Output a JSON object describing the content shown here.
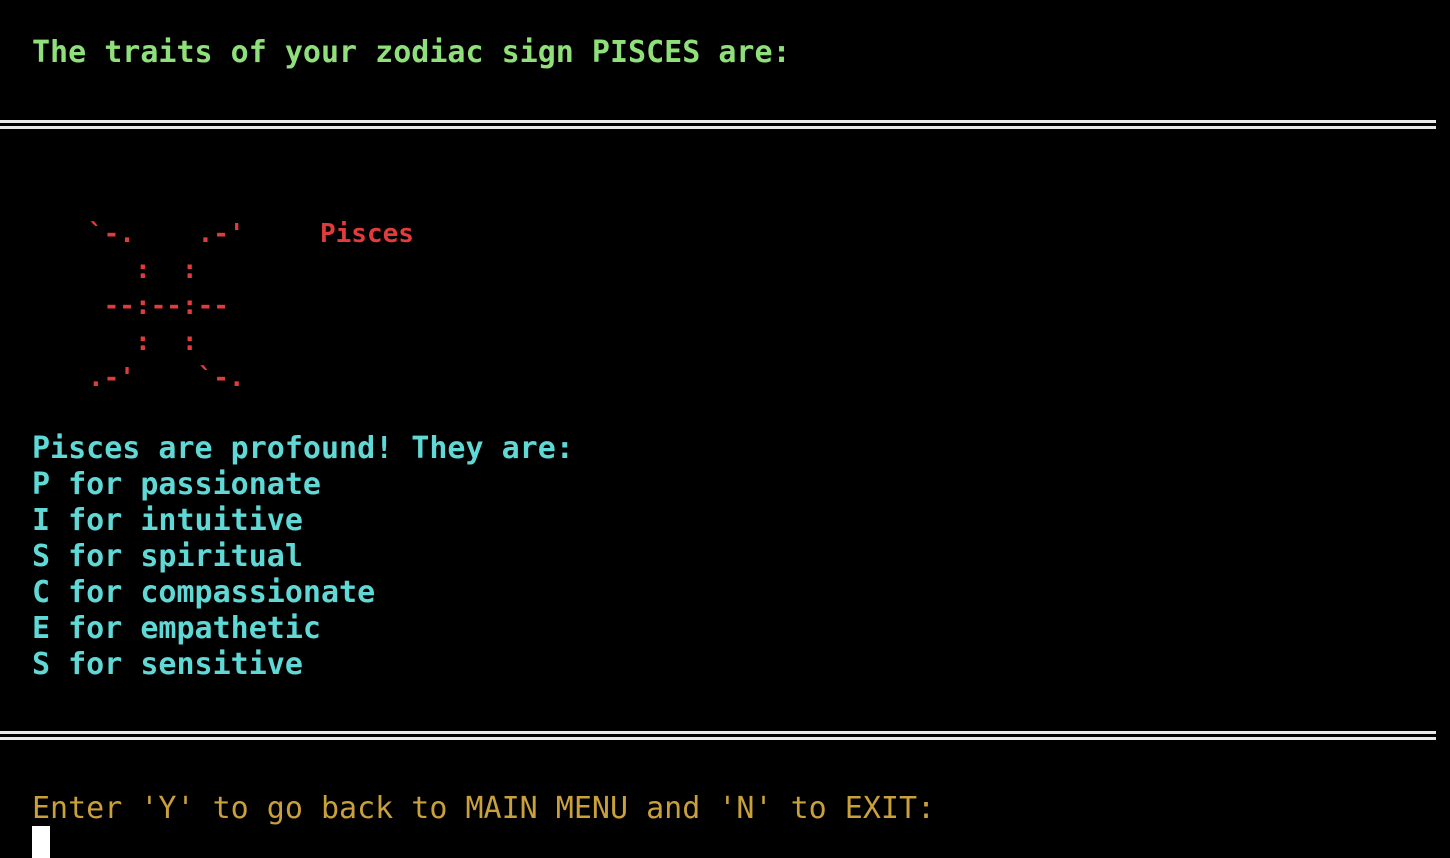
{
  "heading": "The traits of your zodiac sign PISCES are:",
  "ascii_art": [
    "`-.    .-'",
    "   :  :",
    " --:--:--",
    "   :  :",
    ".-'    `-."
  ],
  "sign_name": "Pisces",
  "intro": "Pisces are profound! They are:",
  "traits": [
    "P for passionate",
    "I for intuitive",
    "S for spiritual",
    "C for compassionate",
    "E for empathetic",
    "S for sensitive"
  ],
  "prompt": "Enter 'Y' to go back to MAIN MENU and 'N' to EXIT:",
  "colors": {
    "heading": "#8fe07a",
    "art": "#e23b3b",
    "traits": "#5fd8d6",
    "prompt": "#c9a03a"
  }
}
